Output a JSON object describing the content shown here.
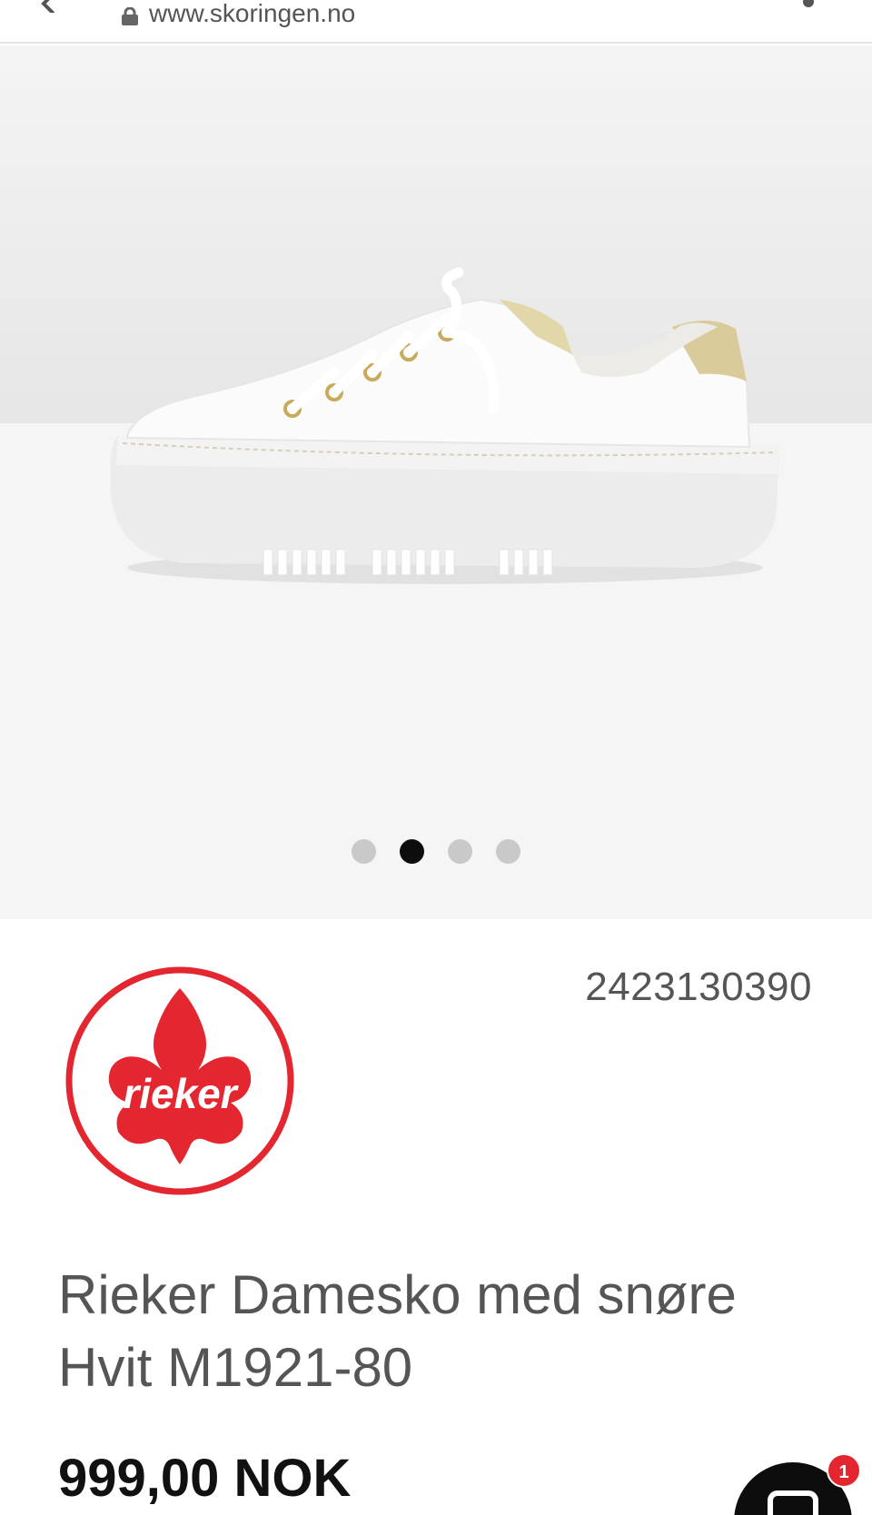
{
  "browser": {
    "url": "www.skoringen.no",
    "icons": {
      "back": "chevron-left-icon",
      "lock": "lock-icon",
      "menu": "more-vertical-icon"
    }
  },
  "gallery": {
    "image": "white-leather-sneaker-image",
    "slides": [
      {
        "active": false
      },
      {
        "active": true
      },
      {
        "active": false
      },
      {
        "active": false
      }
    ]
  },
  "product": {
    "brand_logo": "rieker-logo",
    "brand_logo_text": "rieker",
    "sku": "2423130390",
    "title_line1": "Rieker Damesko med snøre",
    "title_line2": "Hvit M1921-80",
    "price": "999,00 NOK"
  },
  "chat": {
    "icon": "chat-icon",
    "badge_count": "1"
  },
  "colors": {
    "brand_red": "#e3262f",
    "price": "#111111",
    "active_dot": "#0d0d0d",
    "inactive_dot": "#c9c9c9"
  }
}
